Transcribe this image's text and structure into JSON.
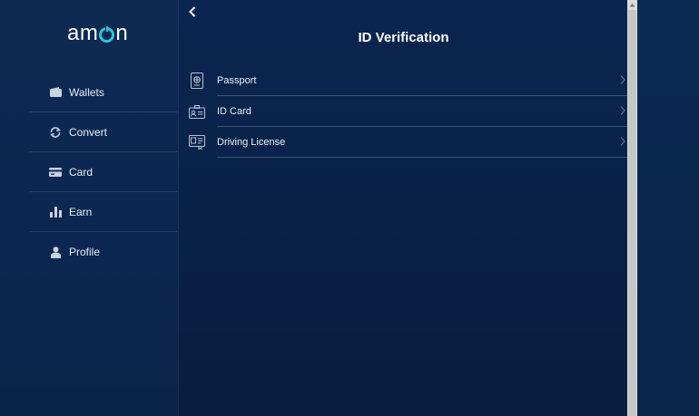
{
  "app": {
    "brand": "amon",
    "brand_parts": [
      "am",
      "n"
    ]
  },
  "sidebar": {
    "items": [
      {
        "label": "Wallets",
        "icon": "wallet-icon"
      },
      {
        "label": "Convert",
        "icon": "convert-icon"
      },
      {
        "label": "Card",
        "icon": "card-icon"
      },
      {
        "label": "Earn",
        "icon": "earn-icon"
      },
      {
        "label": "Profile",
        "icon": "profile-icon"
      }
    ]
  },
  "main": {
    "title": "ID Verification",
    "options": [
      {
        "label": "Passport",
        "icon": "passport-icon"
      },
      {
        "label": "ID Card",
        "icon": "id-card-icon"
      },
      {
        "label": "Driving License",
        "icon": "driving-license-icon"
      }
    ]
  },
  "colors": {
    "accent": "#2ec5d3",
    "background": "#0a2550"
  }
}
